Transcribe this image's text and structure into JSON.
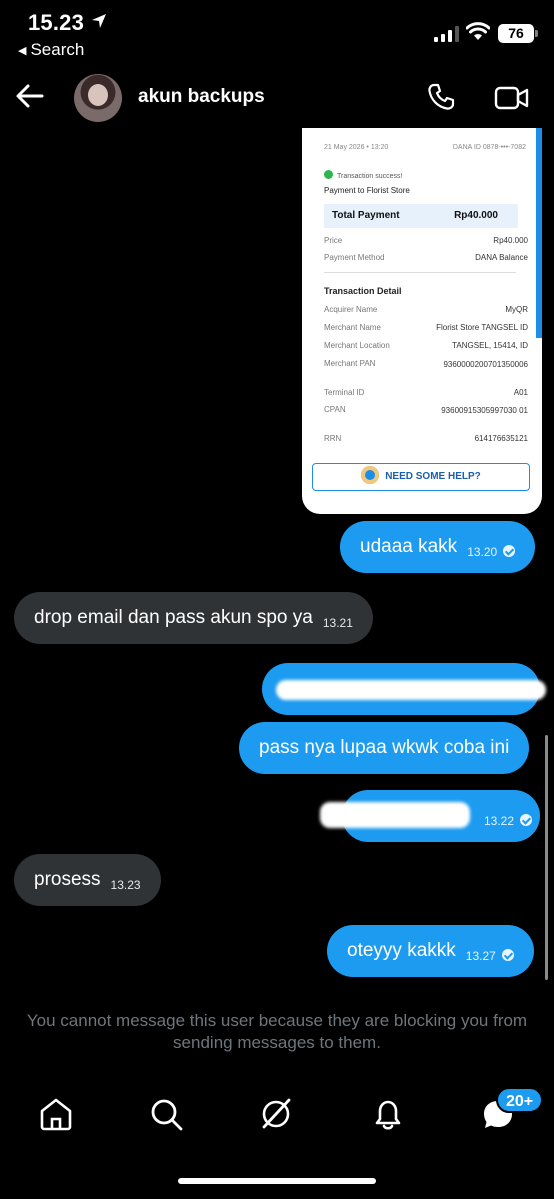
{
  "status_bar": {
    "time": "15.23",
    "back_app": "Search",
    "battery": "76"
  },
  "header": {
    "name": "akun backups"
  },
  "receipt": {
    "date": "21 May 2026 • 13:20",
    "dana_id": "DANA ID 0878-•••-7082",
    "success": "Transaction success!",
    "title": "Payment to Florist Store",
    "total_label": "Total Payment",
    "total_value": "Rp40.000",
    "rows_top": [
      {
        "label": "Price",
        "value": "Rp40.000"
      },
      {
        "label": "Payment Method",
        "value": "DANA Balance"
      }
    ],
    "detail_title": "Transaction Detail",
    "rows_detail": [
      {
        "label": "Acquirer Name",
        "value": "MyQR"
      },
      {
        "label": "Merchant Name",
        "value": "Florist Store TANGSEL ID"
      },
      {
        "label": "Merchant Location",
        "value": "TANGSEL, 15414, ID"
      },
      {
        "label": "Merchant PAN",
        "value": "9360000200701350006"
      },
      {
        "label": "Terminal ID",
        "value": "A01"
      },
      {
        "label": "CPAN",
        "value": "93600915305997030 01"
      },
      {
        "label": "RRN",
        "value": "614176635121"
      }
    ],
    "help": "NEED SOME HELP?"
  },
  "messages": [
    {
      "dir": "out",
      "text": "udaaa kakk",
      "time": "13.20",
      "read": true
    },
    {
      "dir": "in",
      "text": "drop email dan pass akun spo ya",
      "time": "13.21"
    },
    {
      "dir": "out",
      "text": "",
      "time": "",
      "redacted": true
    },
    {
      "dir": "out",
      "text": "pass nya lupaa wkwk coba ini",
      "time": ""
    },
    {
      "dir": "out",
      "text": "",
      "time": "13.22",
      "read": true,
      "redacted": true
    },
    {
      "dir": "in",
      "text": "prosess",
      "time": "13.23"
    },
    {
      "dir": "out",
      "text": "oteyyy kakkk",
      "time": "13.27",
      "read": true
    }
  ],
  "notice": "You cannot message this user because they are blocking you from sending messages to them.",
  "nav": {
    "messages_badge": "20+"
  },
  "colors": {
    "accent": "#1d9bf0",
    "incoming_bubble": "#2f3336",
    "muted": "#6e767d",
    "background": "#000000"
  }
}
